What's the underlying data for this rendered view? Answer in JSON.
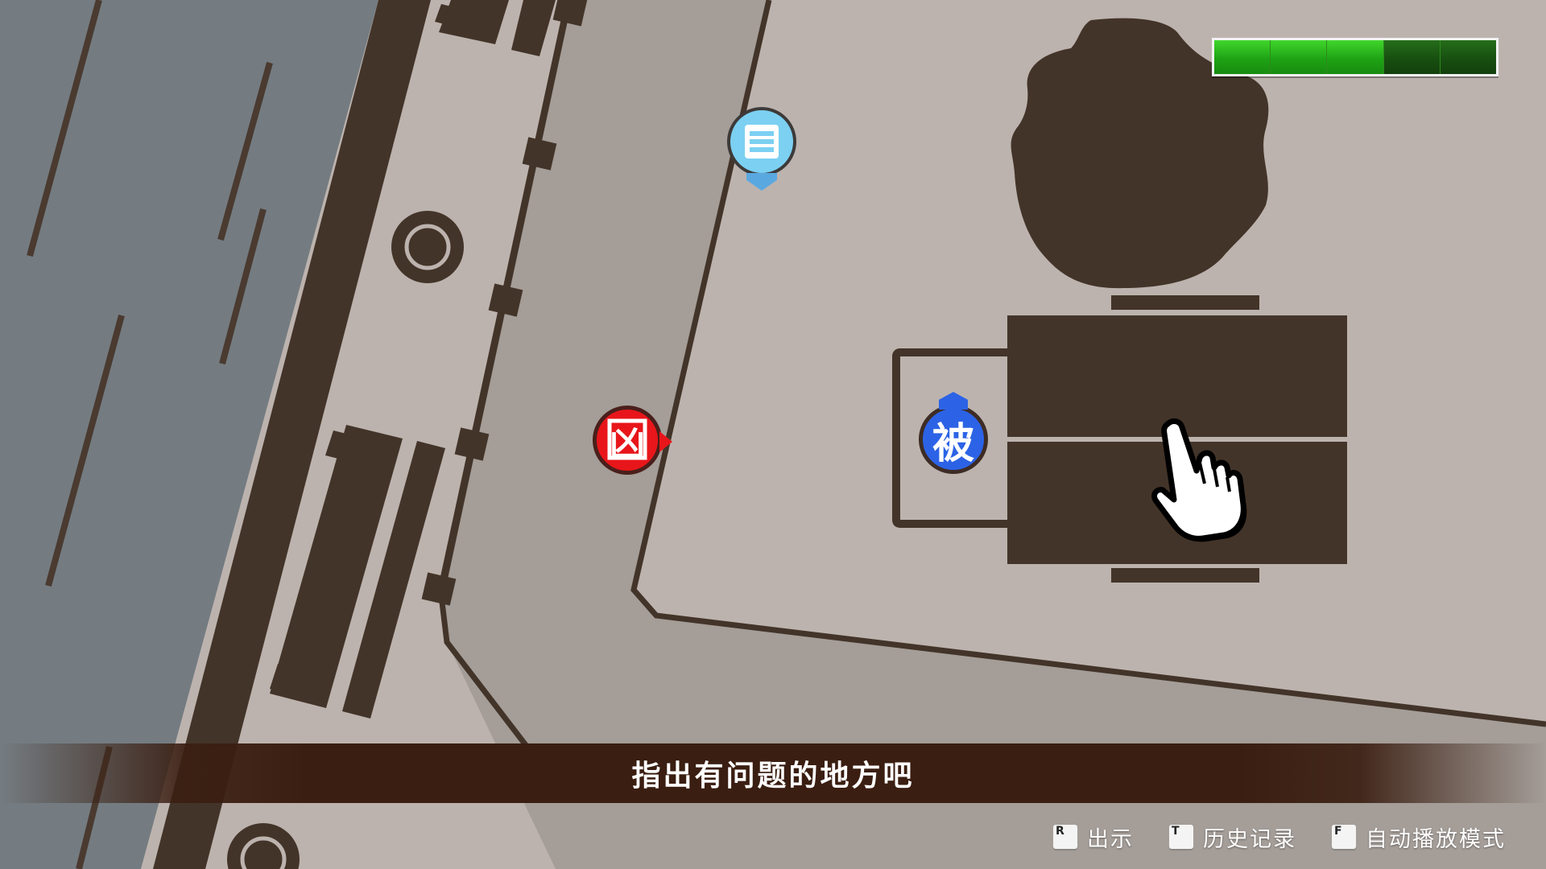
{
  "message": {
    "text": "指出有问题的地方吧"
  },
  "gauge": {
    "segments_total": 5,
    "segments_filled": 3
  },
  "markers": {
    "suspect": {
      "label": "凶",
      "color": "#e8161a"
    },
    "victim": {
      "label": "被",
      "color": "#2c63e6"
    },
    "evidence": {
      "icon": "document-list-icon",
      "color": "#7cd0f2"
    }
  },
  "controls": [
    {
      "key": "R",
      "label": "出示"
    },
    {
      "key": "T",
      "label": "历史记录"
    },
    {
      "key": "F",
      "label": "自动播放模式"
    }
  ],
  "colors": {
    "water": "#747c81",
    "road": "#a49d98",
    "floor": "#bdb3ae",
    "object": "#433429",
    "message_bar": "#3a1e11"
  }
}
